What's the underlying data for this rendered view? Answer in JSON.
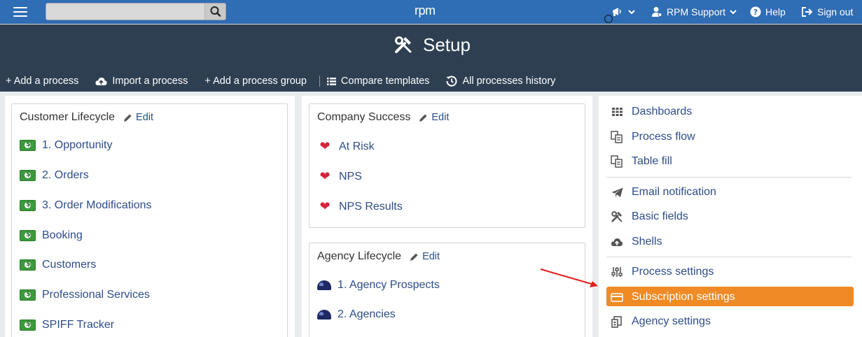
{
  "topbar": {
    "logo": "rpm",
    "search": {
      "placeholder": "",
      "value": ""
    },
    "user_label": "RPM Support",
    "help_label": "Help",
    "signout_label": "Sign out"
  },
  "header": {
    "title": "Setup"
  },
  "toolbar": {
    "add_process": "+ Add a process",
    "import_process": "Import a process",
    "add_group": "+ Add a process group",
    "compare_templates": "Compare templates",
    "history": "All processes history"
  },
  "groups": {
    "customer": {
      "title": "Customer Lifecycle",
      "edit_label": "Edit",
      "items": [
        {
          "label": "1. Opportunity"
        },
        {
          "label": "2. Orders"
        },
        {
          "label": "3. Order Modifications"
        },
        {
          "label": "Booking"
        },
        {
          "label": "Customers"
        },
        {
          "label": "Professional Services"
        },
        {
          "label": "SPIFF Tracker"
        }
      ]
    },
    "company": {
      "title": "Company Success",
      "edit_label": "Edit",
      "items": [
        {
          "label": "At Risk"
        },
        {
          "label": "NPS"
        },
        {
          "label": "NPS Results"
        }
      ]
    },
    "agency": {
      "title": "Agency Lifecycle",
      "edit_label": "Edit",
      "items": [
        {
          "label": "1. Agency Prospects"
        },
        {
          "label": "2. Agencies"
        }
      ]
    }
  },
  "menu": {
    "items": [
      {
        "label": "Dashboards",
        "icon": "grid-icon"
      },
      {
        "label": "Process flow",
        "icon": "flow-icon"
      },
      {
        "label": "Table fill",
        "icon": "table-fill-icon"
      },
      {
        "label": "Email notification",
        "icon": "paper-plane-icon"
      },
      {
        "label": "Basic fields",
        "icon": "tools-icon"
      },
      {
        "label": "Shells",
        "icon": "cloud-icon"
      },
      {
        "label": "Process settings",
        "icon": "sliders-icon"
      },
      {
        "label": "Subscription settings",
        "icon": "credit-card-icon",
        "active": true
      },
      {
        "label": "Agency settings",
        "icon": "agency-icon"
      }
    ]
  },
  "colors": {
    "topbar": "#2f6db5",
    "header": "#2e3f52",
    "link": "#2d4c8a",
    "active": "#f08a24",
    "arrow": "#e0201d"
  }
}
